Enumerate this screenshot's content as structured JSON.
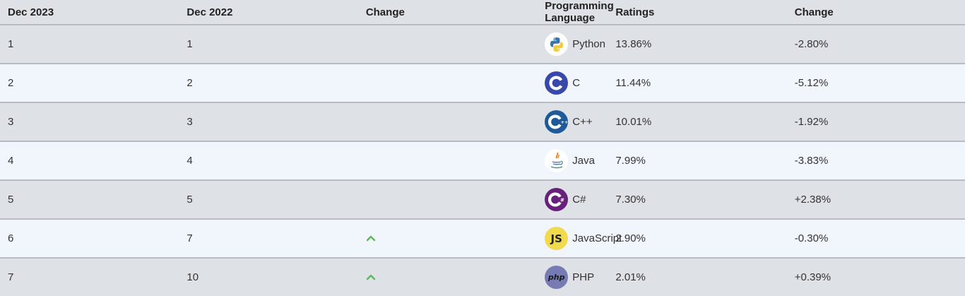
{
  "headers": {
    "current": "Dec 2023",
    "previous": "Dec 2022",
    "change": "Change",
    "language": "Programming Language",
    "ratings": "Ratings",
    "rating_change": "Change"
  },
  "rows": [
    {
      "rank": "1",
      "prev": "1",
      "trend": "",
      "logo": "python-icon",
      "language": "Python",
      "rating": "13.86%",
      "delta": "-2.80%"
    },
    {
      "rank": "2",
      "prev": "2",
      "trend": "",
      "logo": "c-icon",
      "language": "C",
      "rating": "11.44%",
      "delta": "-5.12%"
    },
    {
      "rank": "3",
      "prev": "3",
      "trend": "",
      "logo": "cpp-icon",
      "language": "C++",
      "rating": "10.01%",
      "delta": "-1.92%"
    },
    {
      "rank": "4",
      "prev": "4",
      "trend": "",
      "logo": "java-icon",
      "language": "Java",
      "rating": "7.99%",
      "delta": "-3.83%"
    },
    {
      "rank": "5",
      "prev": "5",
      "trend": "",
      "logo": "csharp-icon",
      "language": "C#",
      "rating": "7.30%",
      "delta": "+2.38%"
    },
    {
      "rank": "6",
      "prev": "7",
      "trend": "up",
      "logo": "javascript-icon",
      "language": "JavaScript",
      "rating": "2.90%",
      "delta": "-0.30%"
    },
    {
      "rank": "7",
      "prev": "10",
      "trend": "up",
      "logo": "php-icon",
      "language": "PHP",
      "rating": "2.01%",
      "delta": "+0.39%"
    }
  ],
  "logo_text": {
    "javascript": "JS",
    "php": "php"
  },
  "colors": {
    "trend_up": "#5cb85c",
    "c_logo": "#3949ab",
    "cpp_logo": "#1e5a9a",
    "csharp_logo": "#68217a",
    "js_logo": "#f0db4f",
    "php_logo": "#777bb3"
  }
}
